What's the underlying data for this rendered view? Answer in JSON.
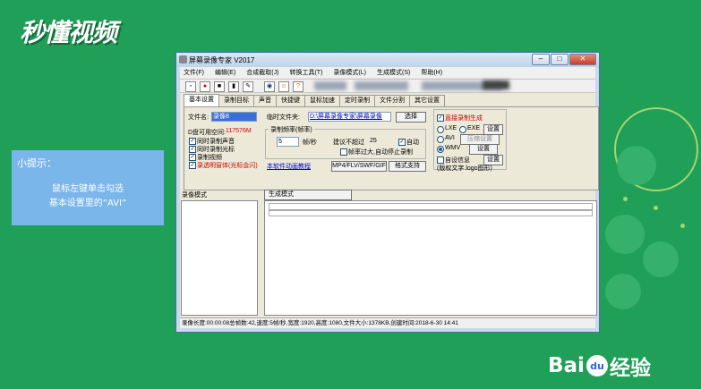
{
  "branding": {
    "watermark": "秒懂视频",
    "corner_logo": "Bai经验",
    "corner_logo_paw": "du"
  },
  "tip": {
    "title": "小提示：",
    "line1": "鼠标左键单击勾选",
    "line2": "基本设置里的“AVI”"
  },
  "window": {
    "title": "屏幕录像专家 V2017",
    "menu": [
      "文件(F)",
      "编辑(E)",
      "合成截取(J)",
      "转换工具(T)",
      "录像模式(L)",
      "生成模式(S)",
      "帮助(H)"
    ],
    "tabs": [
      "基本设置",
      "录制目标",
      "声音",
      "快捷键",
      "鼠标加速",
      "定时录制",
      "文件分割",
      "其它设置"
    ],
    "basic": {
      "filename_label": "文件名:",
      "filename_value": "录像8",
      "temp_label": "临时文件夹:",
      "temp_value": "D:\\屏幕录像专家\\屏幕录像",
      "browse_button": "选择",
      "disk_space_label": "D盘可用空间:",
      "disk_space_value": "117576M",
      "fps_group": "录制频率(帧率)",
      "fps_value": "5",
      "fps_unit": "帧/秒",
      "suggest_label": "建议不超过",
      "suggest_value": "25",
      "auto_label": "自动",
      "auto_stop_label": "帧率过大,自动停止录制",
      "cb_sound": "同时录制声音",
      "cb_cursor": "同时录制光标",
      "cb_video": "录制视频",
      "cb_transparent": "录透明窗体(光标会闪)",
      "tutorial_link": "本软件动画教程",
      "format_label": "MP4/FLV/SWF/GIF",
      "format_button": "格式支持",
      "direct_label": "直接录制生成",
      "opt_lxe": "LXE",
      "opt_exe": "EXE",
      "opt_avi": "AVI",
      "opt_wmv": "WMV",
      "settings_button": "设置",
      "compress_button": "压缩设置",
      "auto_info_label": "自设信息",
      "copyright_label": "(版权文字 logo图形)"
    },
    "list_headers": {
      "left": "录像模式",
      "right": "生成模式"
    },
    "status": "录像长度:00:00:08总帧数:42,速度:5帧/秒,宽度:1920,高度:1080,文件大小:1378KB,创建时间:2018-6-30 14:41"
  },
  "colors": {
    "background": "#1f9f57",
    "tip_box": "#7bb6ea",
    "red_text": "#d00000"
  }
}
